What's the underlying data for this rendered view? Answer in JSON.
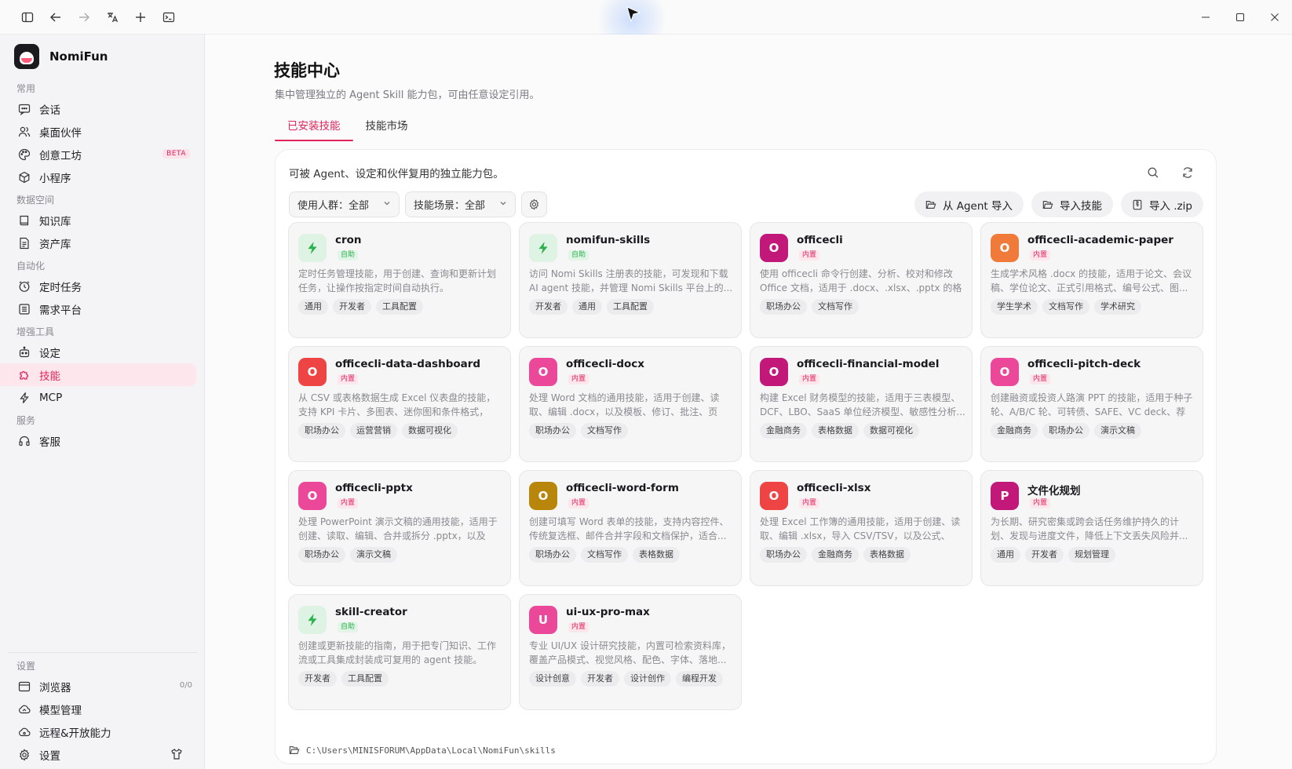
{
  "app": {
    "name": "NomiFun"
  },
  "sidebar": {
    "sections": [
      {
        "title": "常用",
        "items": [
          {
            "label": "会话",
            "icon": "chat-icon"
          },
          {
            "label": "桌面伙伴",
            "icon": "users-icon"
          },
          {
            "label": "创意工坊",
            "icon": "palette-icon",
            "badge": "BETA"
          },
          {
            "label": "小程序",
            "icon": "cube-icon"
          }
        ]
      },
      {
        "title": "数据空间",
        "items": [
          {
            "label": "知识库",
            "icon": "book-icon"
          },
          {
            "label": "资产库",
            "icon": "archive-icon"
          }
        ]
      },
      {
        "title": "自动化",
        "items": [
          {
            "label": "定时任务",
            "icon": "clock-icon"
          },
          {
            "label": "需求平台",
            "icon": "list-icon"
          }
        ]
      },
      {
        "title": "增强工具",
        "items": [
          {
            "label": "设定",
            "icon": "robot-icon"
          },
          {
            "label": "技能",
            "icon": "puzzle-icon",
            "active": true
          },
          {
            "label": "MCP",
            "icon": "bolt-icon"
          }
        ]
      },
      {
        "title": "服务",
        "items": [
          {
            "label": "客服",
            "icon": "headset-icon"
          }
        ]
      }
    ],
    "bottom": {
      "title": "设置",
      "items": [
        {
          "label": "浏览器",
          "icon": "browser-icon",
          "count": "0/0"
        },
        {
          "label": "模型管理",
          "icon": "cloud-icon"
        },
        {
          "label": "远程&开放能力",
          "icon": "cloud-share-icon"
        },
        {
          "label": "设置",
          "icon": "gear-icon"
        }
      ]
    }
  },
  "page": {
    "title": "技能中心",
    "subtitle": "集中管理独立的 Agent Skill 能力包，可由任意设定引用。",
    "tabs": [
      {
        "label": "已安装技能",
        "active": true
      },
      {
        "label": "技能市场"
      }
    ],
    "panel_desc": "可被 Agent、设定和伙伴复用的独立能力包。",
    "filters": {
      "audience": "使用人群：全部",
      "scene": "技能场景：全部"
    },
    "actions": {
      "import_agent": "从 Agent 导入",
      "import_skill": "导入技能",
      "import_zip": "导入 .zip"
    },
    "path": "C:\\Users\\MINISFORUM\\AppData\\Local\\NomiFun\\skills"
  },
  "colors": {
    "accent": "#e0245e",
    "auto_green": "#2bb24c"
  },
  "skills": [
    {
      "name": "cron",
      "tag": "自助",
      "kind": "auto",
      "avatar": "",
      "color": "",
      "desc": "定时任务管理技能，用于创建、查询和更新计划任务，让操作按指定时间自动执行。",
      "chips": [
        "通用",
        "开发者",
        "工具配置"
      ]
    },
    {
      "name": "nomifun-skills",
      "tag": "自助",
      "kind": "auto",
      "avatar": "",
      "color": "",
      "desc": "访问 Nomi Skills 注册表的技能，可发现和下载 AI agent 技能，并管理 Nomi Skills 平台上的...",
      "chips": [
        "开发者",
        "通用",
        "工具配置"
      ]
    },
    {
      "name": "officecli",
      "tag": "内置",
      "kind": "builtin",
      "avatar": "O",
      "color": "#c2187a",
      "desc": "使用 officecli 命令行创建、分析、校对和修改 Office 文档，适用于 .docx、.xlsx、.pptx 的格式...",
      "chips": [
        "职场办公",
        "文档写作"
      ]
    },
    {
      "name": "officecli-academic-paper",
      "tag": "内置",
      "kind": "builtin",
      "avatar": "O",
      "color": "#f07a3a",
      "desc": "生成学术风格 .docx 的技能，适用于论文、会议稿、学位论文、正式引用格式、编号公式、图...",
      "chips": [
        "学生学术",
        "文档写作",
        "学术研究"
      ]
    },
    {
      "name": "officecli-data-dashboard",
      "tag": "内置",
      "kind": "builtin",
      "avatar": "O",
      "color": "#ef4444",
      "desc": "从 CSV 或表格数据生成 Excel 仪表盘的技能，支持 KPI 卡片、多图表、迷你图和条件格式，适...",
      "chips": [
        "职场办公",
        "运营营销",
        "数据可视化"
      ]
    },
    {
      "name": "officecli-docx",
      "tag": "内置",
      "kind": "builtin",
      "avatar": "O",
      "color": "#ec4899",
      "desc": "处理 Word 文档的通用技能，适用于创建、读取、编辑 .docx，以及模板、修订、批注、页眉...",
      "chips": [
        "职场办公",
        "文档写作"
      ]
    },
    {
      "name": "officecli-financial-model",
      "tag": "内置",
      "kind": "builtin",
      "avatar": "O",
      "color": "#c2187a",
      "desc": "构建 Excel 财务模型的技能，适用于三表模型、DCF、LBO、SaaS 单位经济模型、敏感性分析...",
      "chips": [
        "金融商务",
        "表格数据",
        "数据可视化"
      ]
    },
    {
      "name": "officecli-pitch-deck",
      "tag": "内置",
      "kind": "builtin",
      "avatar": "O",
      "color": "#ec4899",
      "desc": "创建融资或投资人路演 PPT 的技能，适用于种子轮、A/B/C 轮、可转债、SAFE、VC deck、荐资...",
      "chips": [
        "金融商务",
        "职场办公",
        "演示文稿"
      ]
    },
    {
      "name": "officecli-pptx",
      "tag": "内置",
      "kind": "builtin",
      "avatar": "O",
      "color": "#ec4899",
      "desc": "处理 PowerPoint 演示文稿的通用技能，适用于创建、读取、编辑、合并或拆分 .pptx，以及模...",
      "chips": [
        "职场办公",
        "演示文稿"
      ]
    },
    {
      "name": "officecli-word-form",
      "tag": "内置",
      "kind": "builtin",
      "avatar": "O",
      "color": "#b8860b",
      "desc": "创建可填写 Word 表单的技能，支持内容控件、传统复选框、邮件合并字段和文档保护，适合...",
      "chips": [
        "职场办公",
        "文档写作",
        "表格数据"
      ]
    },
    {
      "name": "officecli-xlsx",
      "tag": "内置",
      "kind": "builtin",
      "avatar": "O",
      "color": "#ef4444",
      "desc": "处理 Excel 工作簿的通用技能，适用于创建、读取、编辑 .xlsx，导入 CSV/TSV，以及公式、图...",
      "chips": [
        "职场办公",
        "金融商务",
        "表格数据"
      ]
    },
    {
      "name": "文件化规划",
      "tag": "内置",
      "kind": "builtin",
      "avatar": "P",
      "color": "#c2187a",
      "desc": "为长期、研究密集或跨会话任务维护持久的计划、发现与进度文件，降低上下文丢失风险并...",
      "chips": [
        "通用",
        "开发者",
        "规划管理"
      ]
    },
    {
      "name": "skill-creator",
      "tag": "自助",
      "kind": "auto",
      "avatar": "",
      "color": "",
      "desc": "创建或更新技能的指南，用于把专门知识、工作流或工具集成封装成可复用的 agent 技能。",
      "chips": [
        "开发者",
        "工具配置"
      ]
    },
    {
      "name": "ui-ux-pro-max",
      "tag": "内置",
      "kind": "builtin",
      "avatar": "U",
      "color": "#ec4899",
      "desc": "专业 UI/UX 设计研究技能，内置可检索资料库，覆盖产品模式、视觉风格、配色、字体、落地...",
      "chips": [
        "设计创意",
        "开发者",
        "设计创作",
        "编程开发"
      ]
    }
  ]
}
